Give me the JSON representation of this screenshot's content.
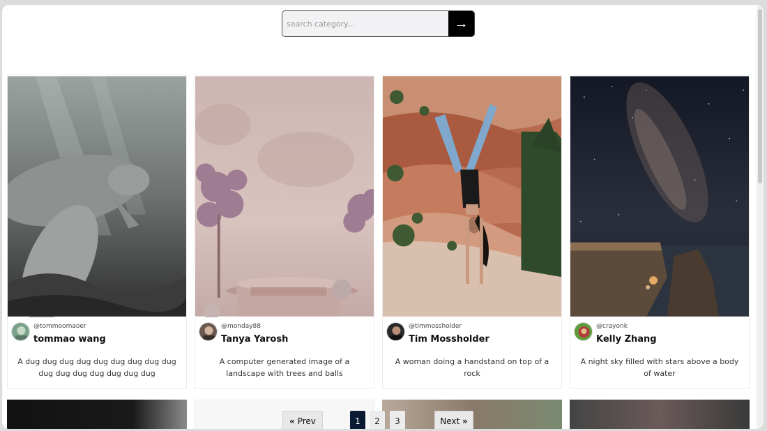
{
  "search": {
    "placeholder": "search category...",
    "value": ""
  },
  "cards": [
    {
      "handle": "@tommoomaoer",
      "name": "tommao wang",
      "description": "A dug dug dug dug dug dug dug dug dug dug dug dug dug dug dug dug"
    },
    {
      "handle": "@monday88",
      "name": "Tanya Yarosh",
      "description": "A computer generated image of a landscape with trees and balls"
    },
    {
      "handle": "@timmossholder",
      "name": "Tim Mossholder",
      "description": "A woman doing a handstand on top of a rock"
    },
    {
      "handle": "@crayonk",
      "name": "Kelly Zhang",
      "description": "A night sky filled with stars above a body of water"
    }
  ],
  "pagination": {
    "prev_label": "Prev",
    "next_label": "Next",
    "pages": [
      "1",
      "2",
      "3"
    ],
    "current": "1"
  },
  "colors": {
    "accent": "#000000",
    "active_page": "#0b1a33"
  }
}
